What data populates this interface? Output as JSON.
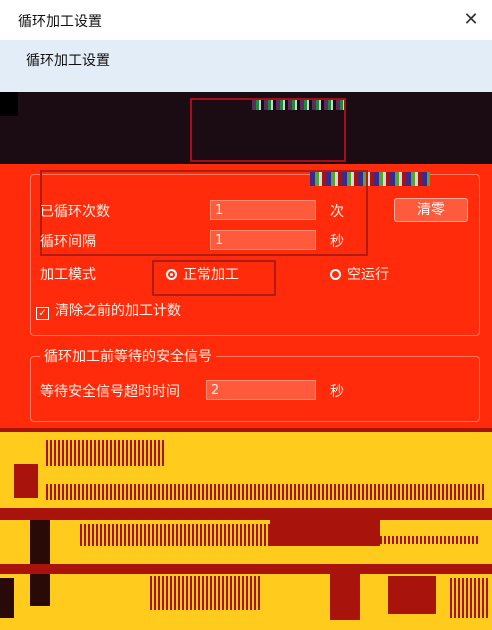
{
  "window": {
    "title": "循环加工设置",
    "close_glyph": "✕"
  },
  "header": {
    "section_title": "循环加工设置"
  },
  "cycle": {
    "cycled_count_label": "已循环次数",
    "cycled_count_value": "1",
    "cycled_count_unit": "次",
    "interval_label": "循环间隔",
    "interval_value": "1",
    "interval_unit": "秒",
    "clear_button": "清零"
  },
  "mode": {
    "label": "加工模式",
    "options": [
      {
        "label": "正常加工",
        "selected": true
      },
      {
        "label": "空运行",
        "selected": false
      }
    ]
  },
  "clear_previous": {
    "label": "清除之前的加工计数",
    "checked": true
  },
  "safety": {
    "group_title": "循环加工前等待的安全信号",
    "timeout_label": "等待安全信号超时时间",
    "timeout_value": "2",
    "timeout_unit": "秒"
  },
  "colors": {
    "red_overlay": "#ff2b0a",
    "yellow_overlay": "#ffcc1d",
    "dark_overlay": "#1b0b13",
    "header_bg": "#e3edf7"
  }
}
